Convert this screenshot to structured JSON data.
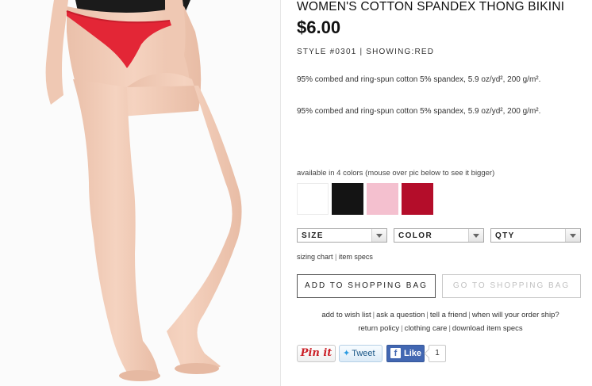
{
  "product": {
    "title": "WOMEN'S COTTON SPANDEX THONG BIKINI",
    "price": "$6.00",
    "style_line": "STYLE #0301 | SHOWING:RED",
    "description_1": "95% combed and ring-spun cotton 5% spandex, 5.9 oz/yd², 200 g/m².",
    "description_2": "95% combed and ring-spun cotton 5% spandex, 5.9 oz/yd², 200 g/m²."
  },
  "colors": {
    "available_text": "available in 4 colors (mouse over pic below to see it bigger)",
    "swatches": [
      {
        "name": "white",
        "hex": "#ffffff"
      },
      {
        "name": "black",
        "hex": "#141414"
      },
      {
        "name": "pink",
        "hex": "#f4c0cf"
      },
      {
        "name": "red",
        "hex": "#b40d2a"
      }
    ]
  },
  "selects": {
    "size": "SIZE",
    "color": "COLOR",
    "qty": "QTY"
  },
  "small_links": {
    "sizing_chart": "sizing chart",
    "separator": "|",
    "item_specs": "item specs"
  },
  "buttons": {
    "add_to_bag": "ADD TO SHOPPING BAG",
    "go_to_bag": "GO TO SHOPPING BAG"
  },
  "links": {
    "row1": [
      "add to wish list",
      "ask a question",
      "tell a friend",
      "when will your order ship?"
    ],
    "row2": [
      "return policy",
      "clothing care",
      "download item specs"
    ],
    "separator": "|"
  },
  "social": {
    "pinit": "Pin it",
    "tweet": "Tweet",
    "like": "Like",
    "like_count": "1"
  },
  "photo": {
    "garment_color": "#e32636",
    "skin_color": "#f2cdb8"
  }
}
